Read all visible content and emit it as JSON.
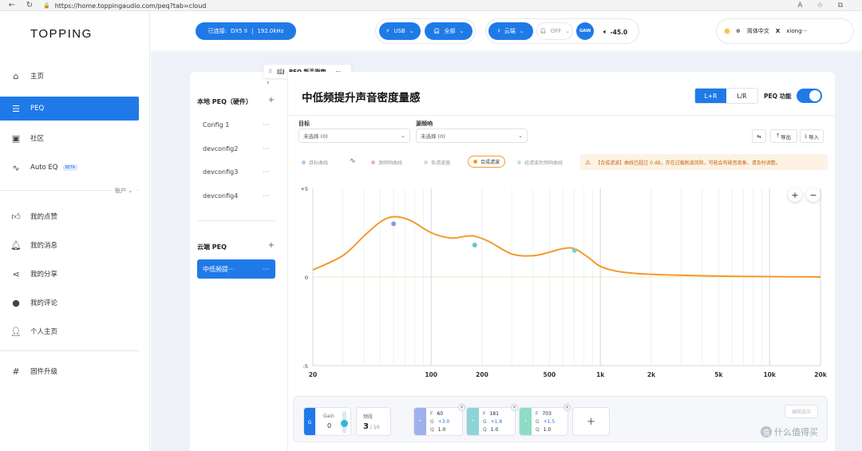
{
  "browser": {
    "url": "https://home.toppingaudio.com/peq?tab=cloud"
  },
  "sidebar": {
    "logo": "TOPPING",
    "items": [
      {
        "label": "主页",
        "icon": "home-icon"
      },
      {
        "label": "PEQ",
        "icon": "sliders-icon",
        "active": true
      },
      {
        "label": "社区",
        "icon": "chat-icon"
      },
      {
        "label": "Auto EQ",
        "icon": "chart-icon",
        "badge": "BETA"
      }
    ],
    "account_label": "账户",
    "account_items": [
      {
        "label": "我的点赞",
        "icon": "thumb-icon"
      },
      {
        "label": "我的消息",
        "icon": "bell-icon"
      },
      {
        "label": "我的分享",
        "icon": "share-icon"
      },
      {
        "label": "我的评论",
        "icon": "comment-icon"
      },
      {
        "label": "个人主页",
        "icon": "user-icon"
      }
    ],
    "firmware": {
      "label": "固件升级",
      "icon": "hash-icon"
    }
  },
  "topbar": {
    "connected_prefix": "已连接:",
    "device": "DX5 II",
    "samplerate": "192.0kHz",
    "input": "USB",
    "output": "全部",
    "cloud": "云端",
    "off": "OFF",
    "gain": "GAIN",
    "volume": "-45.0",
    "language": "简体中文",
    "user": "xiong···"
  },
  "guide": {
    "label": "PEQ 新手指南"
  },
  "left_panel": {
    "local_title": "本地 PEQ（硬件）",
    "local_configs": [
      "Config 1",
      "devconfig2",
      "devconfig3",
      "devconfig4"
    ],
    "cloud_title": "云端 PEQ",
    "cloud_configs": [
      "中低频提···"
    ]
  },
  "main": {
    "title": "中低频提升声音密度量感",
    "lr": "L+R",
    "l_r": "L/R",
    "peq_fn": "PEQ 功能",
    "target_label": "目标",
    "target_value": "未选择 (0)",
    "source_label": "源频响",
    "source_value": "未选择 (0)",
    "export": "导出",
    "import": "导入",
    "legend": [
      {
        "label": "目标曲线",
        "color": "#a9cdf0"
      },
      {
        "label": "源频响曲线",
        "color": "#f0b2b2"
      },
      {
        "label": "各滤波器",
        "color": "#d9d9d9"
      },
      {
        "label": "合成滤波",
        "color": "#f39a2a",
        "selected": true
      },
      {
        "label": "经滤波后频响曲线",
        "color": "#bfe3d6"
      }
    ],
    "warning": "【合成滤波】曲线已超过 0 dB，存在过载削波风险，可能会有破音现象，请及时调整。"
  },
  "chart_data": {
    "type": "line",
    "xscale": "log",
    "xlim": [
      20,
      20000
    ],
    "ylim": [
      -5,
      5
    ],
    "x_ticks": [
      {
        "v": 20,
        "label": "20"
      },
      {
        "v": 100,
        "label": "100"
      },
      {
        "v": 200,
        "label": "200"
      },
      {
        "v": 500,
        "label": "500"
      },
      {
        "v": 1000,
        "label": "1k"
      },
      {
        "v": 2000,
        "label": "2k"
      },
      {
        "v": 5000,
        "label": "5k"
      },
      {
        "v": 10000,
        "label": "10k"
      },
      {
        "v": 20000,
        "label": "20k"
      }
    ],
    "y_ticks": [
      {
        "v": 5,
        "label": "+5"
      },
      {
        "v": 0,
        "label": "0"
      },
      {
        "v": -5,
        "label": "-5"
      }
    ],
    "series": [
      {
        "color": "#f39a2a",
        "x": [
          20,
          30,
          40,
          50,
          60,
          75,
          100,
          130,
          160,
          181,
          220,
          300,
          400,
          500,
          600,
          703,
          850,
          1000,
          1300,
          2000,
          5000,
          10000,
          20000
        ],
        "y": [
          0.4,
          1.2,
          2.3,
          3.1,
          3.4,
          3.2,
          2.5,
          2.2,
          2.3,
          2.3,
          2.0,
          1.3,
          1.2,
          1.4,
          1.6,
          1.6,
          1.1,
          0.6,
          0.3,
          0.15,
          0.05,
          0.02,
          0.0
        ]
      }
    ],
    "points": [
      {
        "x": 60,
        "y": 3.0,
        "color": "#8a9be0"
      },
      {
        "x": 181,
        "y": 1.8,
        "color": "#6ec2cc"
      },
      {
        "x": 703,
        "y": 1.5,
        "color": "#7ed0bf"
      }
    ]
  },
  "bottom": {
    "gain_letter": "G",
    "gain_label": "Gain",
    "gain_value": "0",
    "bands_label": "频段",
    "bands_value": "3",
    "bands_total": "/ 10",
    "filters": [
      {
        "F": "60",
        "G": "+3.0",
        "Q": "1.0",
        "color": "#9fb0ef"
      },
      {
        "F": "181",
        "G": "+1.8",
        "Q": "1.0",
        "color": "#8fd3d8"
      },
      {
        "F": "703",
        "G": "+1.5",
        "Q": "1.0",
        "color": "#8edbc8"
      }
    ],
    "edit_label": "编辑选中",
    "watermark": "什么值得买"
  }
}
